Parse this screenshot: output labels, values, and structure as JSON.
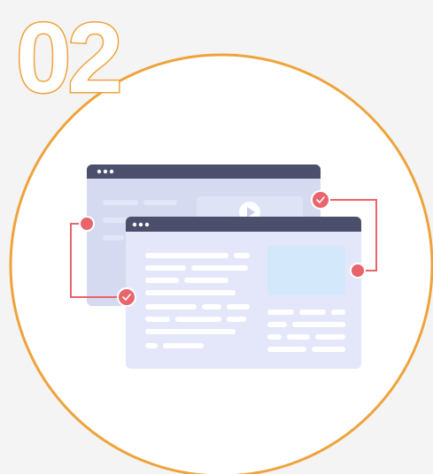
{
  "step": {
    "number": "02"
  },
  "colors": {
    "background": "#f4f4f4",
    "accent_orange": "#eea33c",
    "accent_red": "#e8656b",
    "window_bar": "#4b4f6b",
    "window_back": "#d6daf0",
    "window_front": "#e4e7fa",
    "placeholder": "#ffffff",
    "image_box": "#d3e9fb"
  },
  "icons": {
    "connector_check": "check-icon",
    "window_controls": "three-dots-icon",
    "media": "play-icon"
  }
}
